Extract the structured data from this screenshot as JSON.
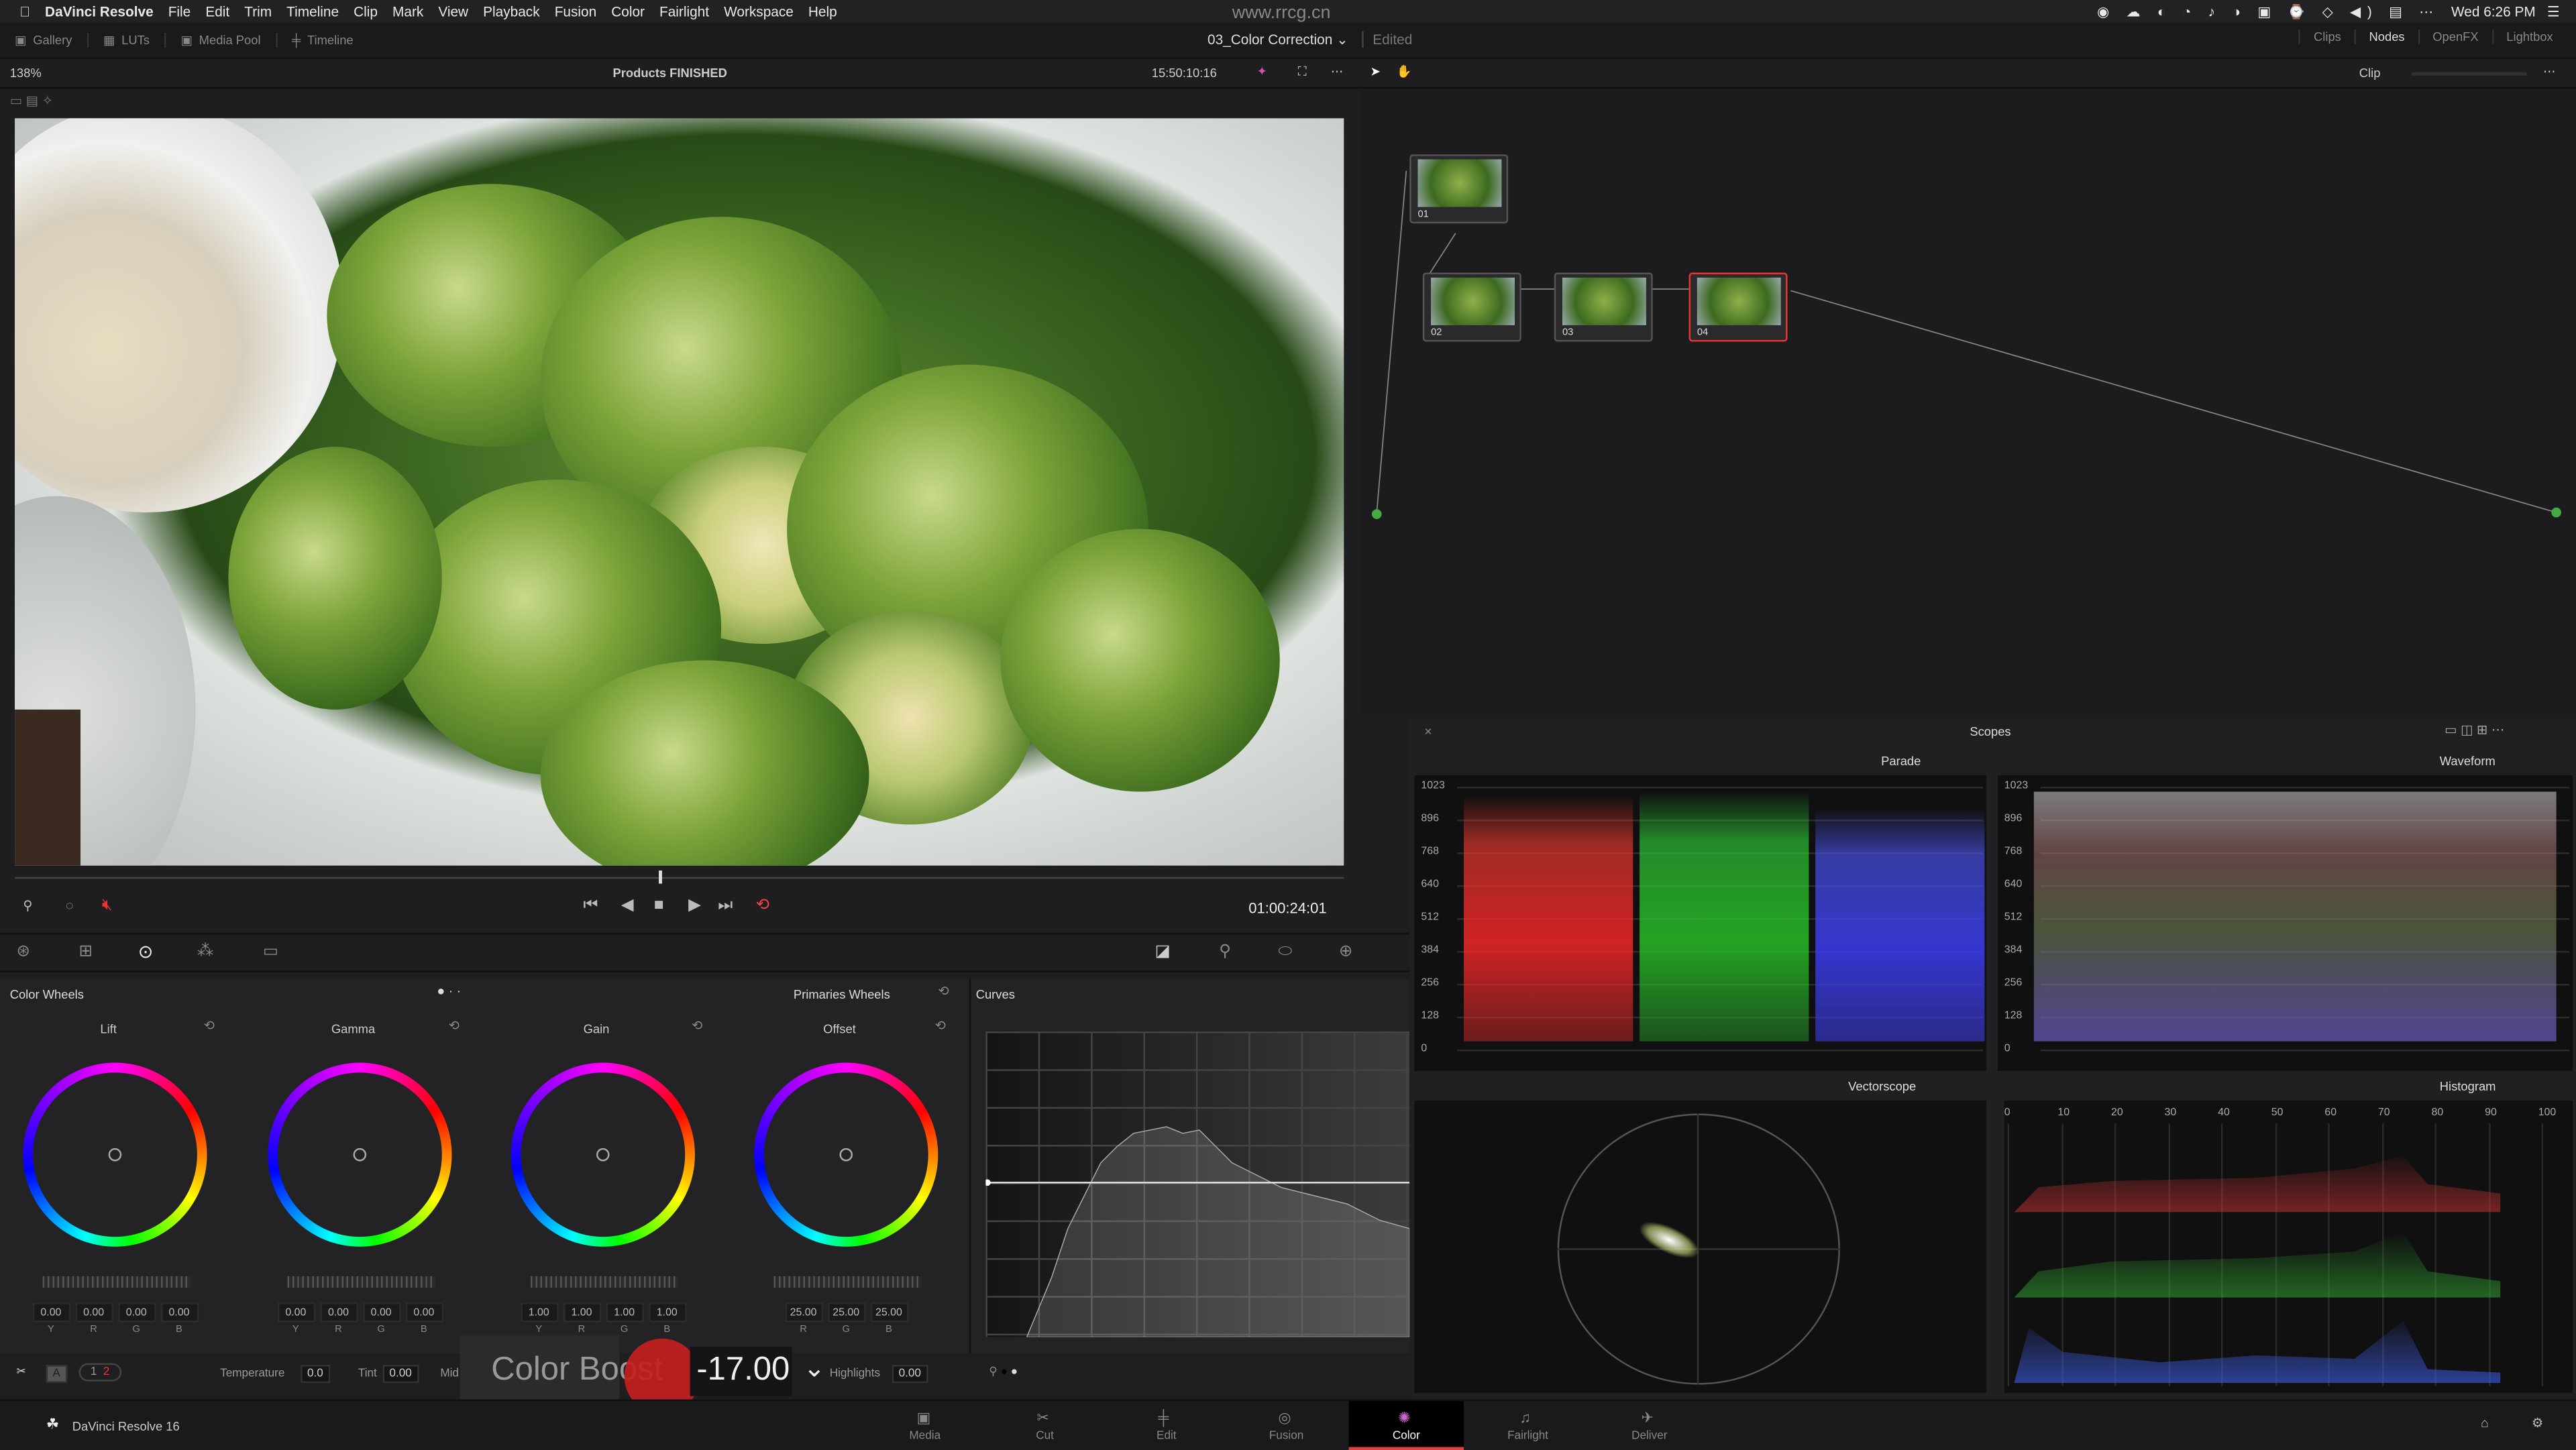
{
  "menubar": {
    "app": "DaVinci Resolve",
    "items": [
      "File",
      "Edit",
      "Trim",
      "Timeline",
      "Clip",
      "Mark",
      "View",
      "Playback",
      "Fusion",
      "Color",
      "Fairlight",
      "Workspace",
      "Help"
    ],
    "clock": "Wed 6:26 PM",
    "watermark": "www.rrcg.cn"
  },
  "toolbar": {
    "left": [
      "Gallery",
      "LUTs",
      "Media Pool",
      "Timeline"
    ],
    "project": "03_Color Correction",
    "state": "Edited",
    "right": [
      "Clips",
      "Nodes",
      "OpenFX",
      "Lightbox"
    ]
  },
  "viewer": {
    "zoom": "138%",
    "timeline": "Products FINISHED",
    "timecode": "15:50:10:16",
    "playhead_timecode": "01:00:24:01"
  },
  "nodes": {
    "mode": "Clip",
    "items": [
      {
        "label": "01"
      },
      {
        "label": "02"
      },
      {
        "label": "03"
      },
      {
        "label": "04"
      }
    ],
    "selected": "04"
  },
  "wheels": {
    "title": "Color Wheels",
    "mode": "Primaries Wheels",
    "wheels": [
      {
        "name": "Lift",
        "values": [
          "0.00",
          "0.00",
          "0.00",
          "0.00"
        ],
        "labels": [
          "Y",
          "R",
          "G",
          "B"
        ]
      },
      {
        "name": "Gamma",
        "values": [
          "0.00",
          "0.00",
          "0.00",
          "0.00"
        ],
        "labels": [
          "Y",
          "R",
          "G",
          "B"
        ]
      },
      {
        "name": "Gain",
        "values": [
          "1.00",
          "1.00",
          "1.00",
          "1.00"
        ],
        "labels": [
          "Y",
          "R",
          "G",
          "B"
        ]
      },
      {
        "name": "Offset",
        "values": [
          "25.00",
          "25.00",
          "25.00"
        ],
        "labels": [
          "R",
          "G",
          "B"
        ]
      }
    ]
  },
  "curves": {
    "title": "Curves"
  },
  "bottom": {
    "page1": "1",
    "page2": "2",
    "temperature_label": "Temperature",
    "temperature": "0.0",
    "tint_label": "Tint",
    "tint": "0.00",
    "mid_label": "Mid",
    "highlights_label": "Highlights",
    "highlights": "0.00"
  },
  "boost": {
    "label": "Color Boost",
    "value": "-17.00"
  },
  "scopes": {
    "title": "Scopes",
    "parade": "Parade",
    "waveform": "Waveform",
    "vectorscope": "Vectorscope",
    "histogram": "Histogram",
    "y_ticks": [
      "1023",
      "896",
      "768",
      "640",
      "512",
      "384",
      "256",
      "128",
      "0"
    ],
    "hist_ticks": [
      "0",
      "10",
      "20",
      "30",
      "40",
      "50",
      "60",
      "70",
      "80",
      "90",
      "100"
    ]
  },
  "pages": {
    "brand": "DaVinci Resolve 16",
    "items": [
      "Media",
      "Cut",
      "Edit",
      "Fusion",
      "Color",
      "Fairlight",
      "Deliver"
    ],
    "active": "Color"
  }
}
